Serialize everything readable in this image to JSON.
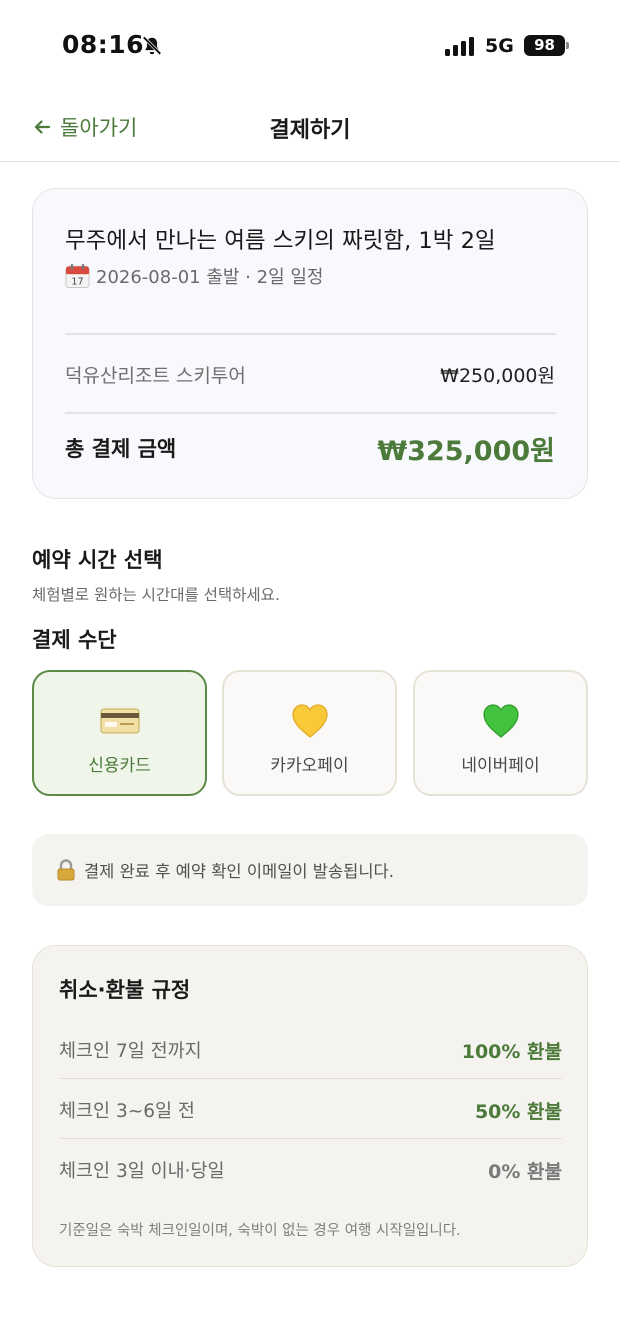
{
  "status_bar": {
    "time": "08:16",
    "network": "5G",
    "battery": "98",
    "muted": true
  },
  "nav": {
    "back_label": "돌아가기",
    "title": "결제하기"
  },
  "summary": {
    "title": "무주에서 만나는 여름 스키의 짜릿함, 1박 2일",
    "meta": "2026-08-01 출발 · 2일 일정",
    "item_name": "덕유산리조트 스키투어",
    "item_price": "₩250,000원",
    "total_label": "총 결제 금액",
    "total_value": "₩325,000원"
  },
  "reservation": {
    "title": "예약 시간 선택",
    "subtitle": "체험별로 원하는 시간대를 선택하세요."
  },
  "payment": {
    "title": "결제 수단",
    "options": [
      {
        "label": "신용카드",
        "icon": "credit-card-icon",
        "selected": true
      },
      {
        "label": "카카오페이",
        "icon": "yellow-heart-icon",
        "selected": false
      },
      {
        "label": "네이버페이",
        "icon": "green-heart-icon",
        "selected": false
      }
    ]
  },
  "notice": {
    "text": "결제 완료 후 예약 확인 이메일이 발송됩니다."
  },
  "policy": {
    "title": "취소·환불 규정",
    "rows": [
      {
        "condition": "체크인 7일 전까지",
        "value": "100% 환불",
        "color": "#4c7a3a"
      },
      {
        "condition": "체크인 3~6일 전",
        "value": "50% 환불",
        "color": "#4c7a3a"
      },
      {
        "condition": "체크인 3일 이내·당일",
        "value": "0% 환불",
        "color": "#7a7a7a"
      }
    ],
    "note": "기준일은 숙박 체크인일이며, 숙박이 없는 경우 여행 시작일입니다."
  },
  "colors": {
    "accent": "#4c7a3a",
    "card_bg": "#f8f9fc",
    "policy_bg": "#f5f3ef"
  }
}
